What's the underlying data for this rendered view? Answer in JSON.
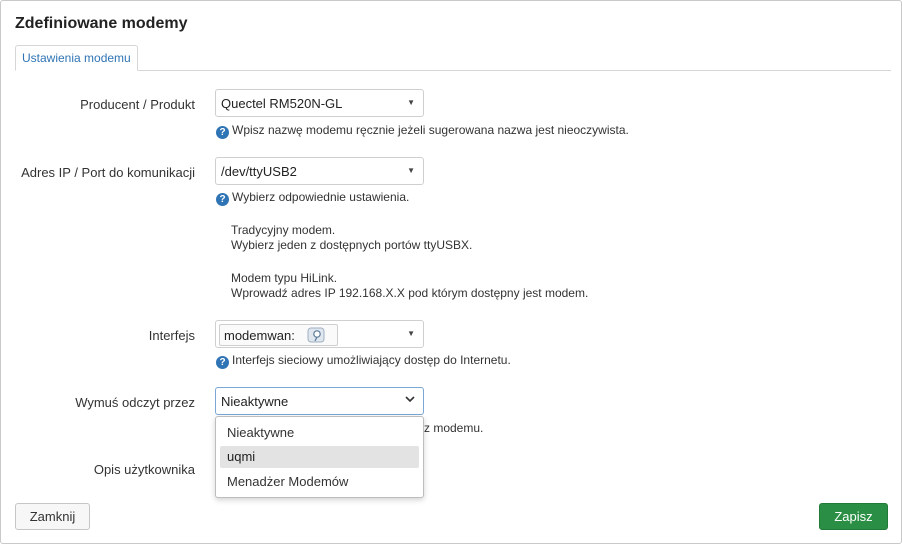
{
  "dialog": {
    "title": "Zdefiniowane modemy",
    "tab": "Ustawienia modemu"
  },
  "fields": {
    "manufacturer": {
      "label": "Producent / Produkt",
      "value": "Quectel RM520N-GL",
      "help": "Wpisz nazwę modemu ręcznie jeżeli sugerowana nazwa jest nieoczywista."
    },
    "port": {
      "label": "Adres IP / Port do komunikacji",
      "value": "/dev/ttyUSB2",
      "help": "Wybierz odpowiednie ustawienia.",
      "desc1_line1": "Tradycyjny modem.",
      "desc1_line2": "Wybierz jeden z dostępnych portów ttyUSBX.",
      "desc2_line1": "Modem typu HiLink.",
      "desc2_line2": "Wprowadź adres IP 192.168.X.X pod którym dostępny jest modem."
    },
    "interface": {
      "label": "Interfejs",
      "chip": "modemwan:",
      "chip_icon": "network-icon",
      "help": "Interfejs sieciowy umożliwiający dostęp do Internetu."
    },
    "force_read": {
      "label": "Wymuś odczyt przez",
      "value": "Nieaktywne",
      "help_visible": "z modemu.",
      "options": [
        "Nieaktywne",
        "uqmi",
        "Menadżer Modemów"
      ],
      "highlighted": "uqmi"
    },
    "user_desc": {
      "label": "Opis użytkownika"
    }
  },
  "buttons": {
    "close": "Zamknij",
    "save": "Zapisz"
  },
  "colors": {
    "accent": "#2f74b5",
    "save": "#2a8f45"
  }
}
